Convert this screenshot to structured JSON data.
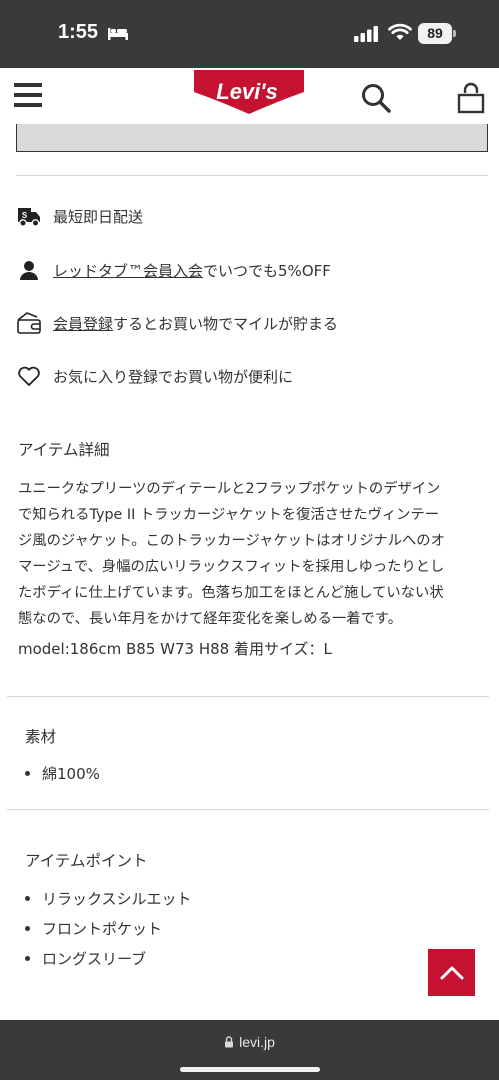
{
  "status_bar": {
    "time": "1:55",
    "battery": "89"
  },
  "header": {
    "logo_text": "Levi's"
  },
  "features": [
    {
      "icon": "truck-icon",
      "text": "最短即日配送"
    },
    {
      "icon": "person-icon",
      "link": "レッドタブ™会員入会",
      "text": "でいつでも5%OFF"
    },
    {
      "icon": "wallet-icon",
      "link": "会員登録",
      "text": "するとお買い物でマイルが貯まる"
    },
    {
      "icon": "heart-icon",
      "text": "お気に入り登録でお買い物が便利に"
    }
  ],
  "item_details": {
    "heading": "アイテム詳細",
    "lines": [
      "ユニークなプリーツのディテールと2フラップポケットのデザイン",
      "で知られるType II トラッカージャケットを復活させたヴィンテー",
      "ジ風のジャケット。このトラッカージャケットはオリジナルへのオ",
      "マージュで、身幅の広いリラックスフィットを採用しゆったりとし",
      "たボディに仕上げています。色落ち加工をほとんど施していない状",
      "態なので、長い年月をかけて経年変化を楽しめる一着です。"
    ],
    "model": "model:186cm B85 W73 H88 着用サイズ：L"
  },
  "material": {
    "heading": "素材",
    "items": [
      "綿100%"
    ]
  },
  "item_points": {
    "heading": "アイテムポイント",
    "items": [
      "リラックスシルエット",
      "フロントポケット",
      "ロングスリーブ"
    ]
  },
  "colors": {
    "brand_red": "#c41230",
    "status_bar_bg": "#3a3a3a"
  },
  "browser": {
    "url": "levi.jp"
  }
}
